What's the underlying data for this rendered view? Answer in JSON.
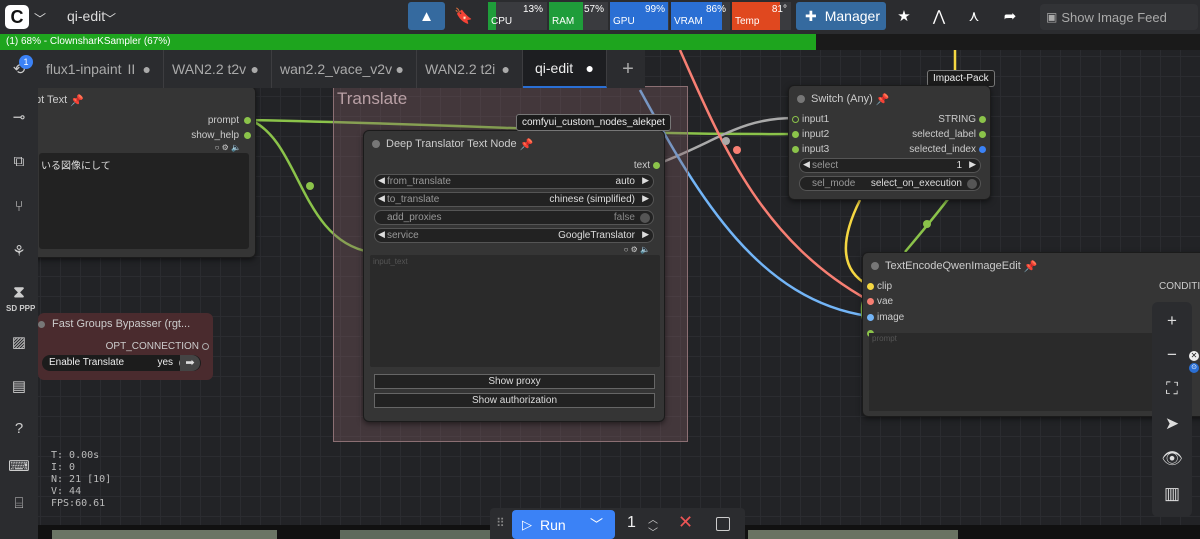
{
  "topbar": {
    "logo_glyph": "C",
    "workflow_name": "qi-edit",
    "meters": [
      {
        "label": "CPU",
        "value": "13%",
        "percent": 13,
        "color": "#1f9d3a"
      },
      {
        "label": "RAM",
        "value": "57%",
        "percent": 57,
        "color": "#1f9d3a"
      },
      {
        "label": "GPU",
        "value": "99%",
        "percent": 99,
        "color": "#2a6fd4"
      },
      {
        "label": "VRAM",
        "value": "86%",
        "percent": 86,
        "color": "#2a6fd4"
      },
      {
        "label": "Temp",
        "value": "81°",
        "percent": 81,
        "color": "#e0481f"
      }
    ],
    "manager_label": "Manager",
    "feed_label": "Show Image Feed"
  },
  "progress": {
    "text": "(1) 68% - ClownsharKSampler (67%)",
    "percent": 68
  },
  "tabs": [
    {
      "label": "flux1-inpaint",
      "suffix": "II",
      "dot": "●"
    },
    {
      "label": "WAN2.2 t2v",
      "suffix": "",
      "dot": "●"
    },
    {
      "label": "wan2.2_vace_v2v",
      "suffix": "",
      "dot": "●"
    },
    {
      "label": "WAN2.2 t2i",
      "suffix": "",
      "dot": "●"
    },
    {
      "label": "qi-edit",
      "suffix": "",
      "dot": "●"
    }
  ],
  "tab_add": "+",
  "sidebar": {
    "badge": "1",
    "sd_ppp": "SD PPP"
  },
  "prompt_node": {
    "title_partial": "pt Text",
    "out_prompt": "prompt",
    "out_show_help": "show_help",
    "text_partial": "いる図像にして"
  },
  "group_translate": {
    "title": "Translate"
  },
  "translator_node": {
    "title": "Deep Translator Text Node",
    "out_text": "text",
    "widgets": [
      {
        "name": "from_translate",
        "value": "auto"
      },
      {
        "name": "to_translate",
        "value": "chinese (simplified)"
      },
      {
        "name": "add_proxies",
        "value": "false"
      },
      {
        "name": "service",
        "value": "GoogleTranslator"
      }
    ],
    "input_text_label": "input_text",
    "btn_proxy": "Show proxy",
    "btn_auth": "Show authorization"
  },
  "switch_node": {
    "badge": "Impact-Pack",
    "title": "Switch (Any)",
    "inputs": [
      "input1",
      "input2",
      "input3"
    ],
    "outputs": [
      "STRING",
      "selected_label",
      "selected_index"
    ],
    "select_label": "select",
    "select_value": "1",
    "sel_mode_label": "sel_mode",
    "sel_mode_value": "select_on_execution"
  },
  "tooltip_alekpet": "comfyui_custom_nodes_alekpet",
  "encode_node": {
    "title": "TextEncodeQwenImageEdit",
    "inputs": [
      "clip",
      "vae",
      "image"
    ],
    "output_partial": "CONDITIO",
    "prompt_label": "prompt"
  },
  "fast_groups": {
    "title": "Fast Groups Bypasser (rgt...",
    "output": "OPT_CONNECTION",
    "toggle_label": "Enable Translate",
    "toggle_value": "yes"
  },
  "stats": {
    "t": "T: 0.00s",
    "i": "I: 0",
    "n": "N: 21 [10]",
    "v": "V: 44",
    "fps": "FPS:60.61"
  },
  "runbar": {
    "run_label": "Run",
    "count": "1"
  },
  "colors": {
    "accent": "#3b82f6",
    "progress": "#1ea51e",
    "wire_green": "#8bc34a",
    "wire_red": "#f77f73",
    "wire_blue": "#73b5f7",
    "wire_yellow": "#f5d742",
    "wire_gray": "#aaaaaa"
  }
}
